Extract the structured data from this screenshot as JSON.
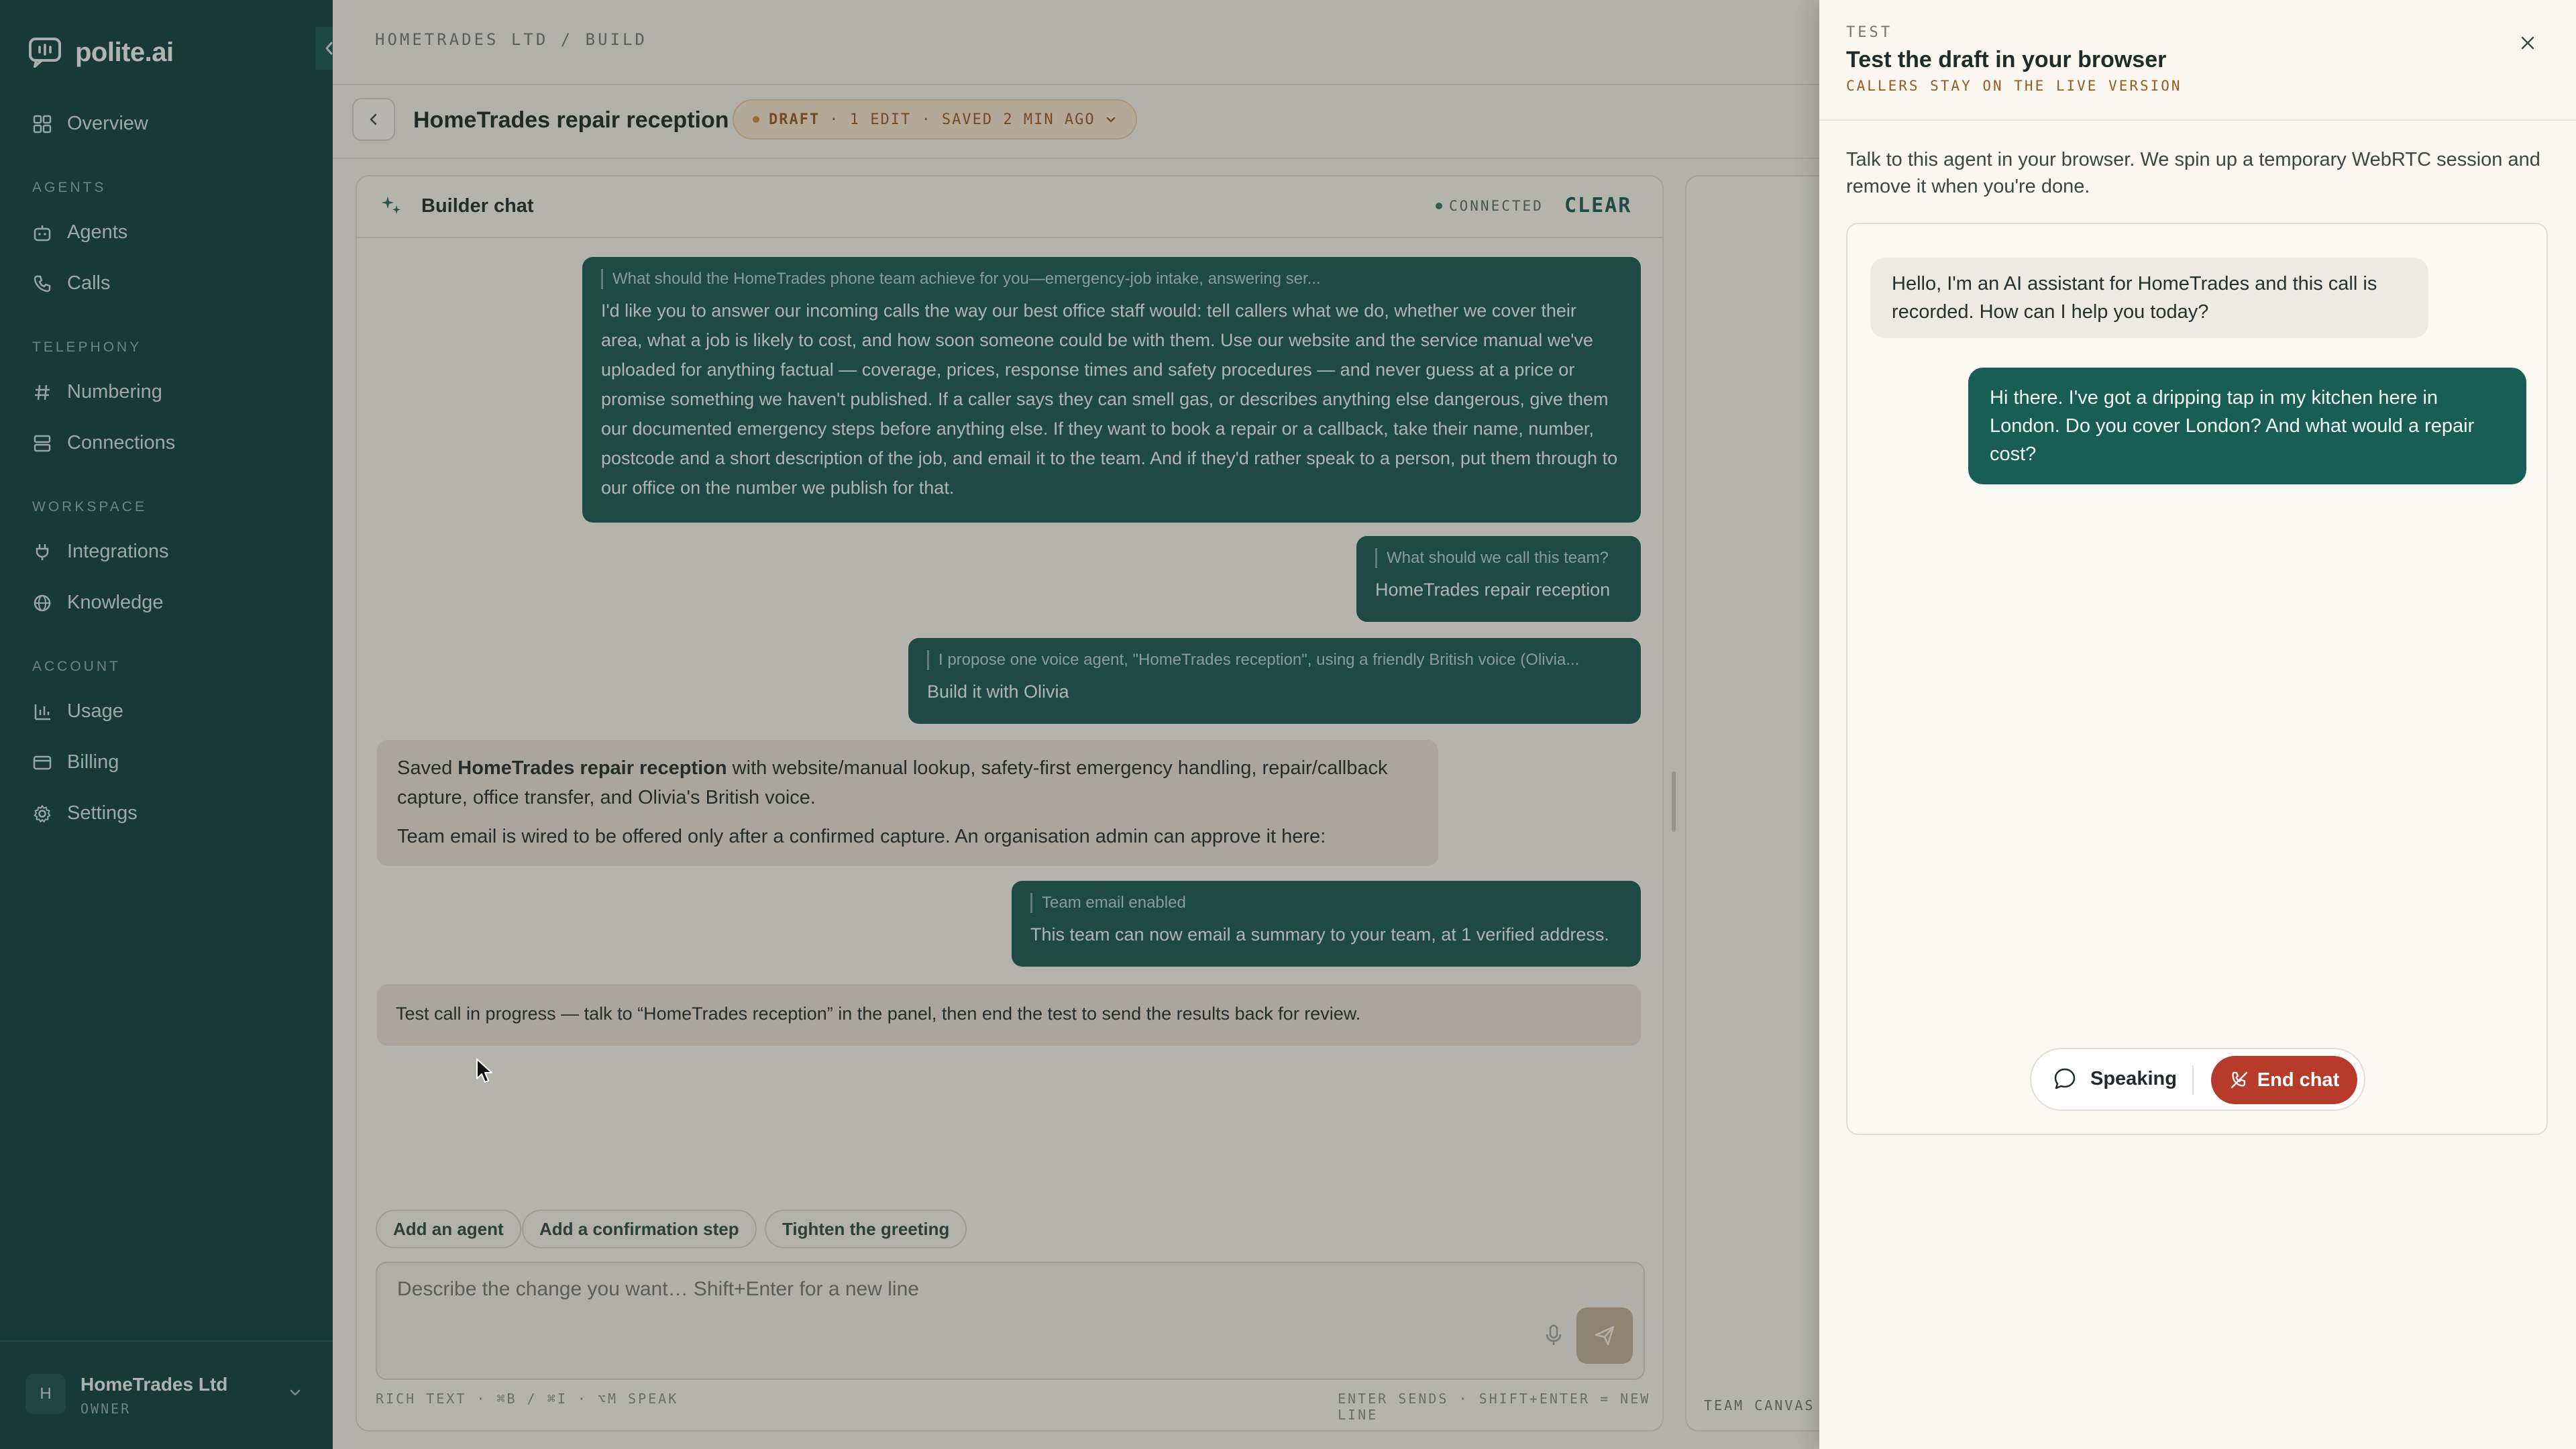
{
  "app": {
    "logo_text": "polite.ai",
    "brand_color": "#0f4340",
    "accent_color": "#1b5a52",
    "danger_color": "#b83a2b"
  },
  "sidebar": {
    "overview": "Overview",
    "sections": {
      "agents": "AGENTS",
      "telephony": "TELEPHONY",
      "workspace": "WORKSPACE",
      "account": "ACCOUNT"
    },
    "items": {
      "agents": "Agents",
      "calls": "Calls",
      "numbering": "Numbering",
      "connections": "Connections",
      "integrations": "Integrations",
      "knowledge": "Knowledge",
      "usage": "Usage",
      "billing": "Billing",
      "settings": "Settings"
    },
    "org": {
      "initial": "H",
      "name": "HomeTrades Ltd",
      "role": "OWNER"
    }
  },
  "header": {
    "breadcrumb": "HOMETRADES LTD / BUILD",
    "title": "HomeTrades repair reception",
    "draft_badge": {
      "status": "DRAFT",
      "detail": "· 1 EDIT · SAVED 2 MIN AGO"
    }
  },
  "builder_chat": {
    "title": "Builder chat",
    "connection": "CONNECTED",
    "clear_label": "CLEAR",
    "messages": [
      {
        "quote": "What should the HomeTrades phone team achieve for you—emergency-job intake, answering ser...",
        "text": "I'd like you to answer our incoming calls the way our best office staff would: tell callers what we do, whether we cover their area, what a job is likely to cost, and how soon someone could be with them. Use our website and the service manual we've uploaded for anything factual — coverage, prices, response times and safety procedures — and never guess at a price or promise something we haven't published. If a caller says they can smell gas, or describes anything else dangerous, give them our documented emergency steps before anything else. If they want to book a repair or a callback, take their name, number, postcode and a short description of the job, and email it to the team. And if they'd rather speak to a person, put them through to our office on the number we publish for that."
      },
      {
        "quote": "What should we call this team?",
        "text": "HomeTrades repair reception"
      },
      {
        "quote": "I propose one voice agent, \"HomeTrades reception\", using a friendly British voice (Olivia...",
        "text": "Build it with Olivia"
      },
      {
        "saved_prefix": "Saved ",
        "saved_name": "HomeTrades repair reception",
        "saved_suffix": " with website/manual lookup, safety-first emergency handling, repair/callback capture, office transfer, and Olivia's British voice.",
        "line2": "Team email is wired to be offered only after a confirmed capture. An organisation admin can approve it here:"
      },
      {
        "quote": "Team email enabled",
        "text": "This team can now email a summary to your team, at 1 verified address."
      },
      {
        "text": "Test call in progress — talk to “HomeTrades reception” in the panel, then end the test to send the results back for review."
      }
    ],
    "suggestions": [
      "Add an agent",
      "Add a confirmation step",
      "Tighten the greeting"
    ],
    "composer": {
      "placeholder": "Describe the change you want… Shift+Enter for a new line",
      "hint_left": "RICH TEXT · ⌘B / ⌘I · ⌥M SPEAK",
      "hint_right": "ENTER SENDS · SHIFT+ENTER = NEW LINE"
    }
  },
  "canvas": {
    "label": "TEAM CANVAS ·"
  },
  "test_panel": {
    "eyebrow": "TEST",
    "title": "Test the draft in your browser",
    "subtitle": "CALLERS STAY ON THE LIVE VERSION",
    "description": "Talk to this agent in your browser. We spin up a temporary WebRTC session and remove it when you're done.",
    "conversation": {
      "agent": "Hello, I'm an AI assistant for HomeTrades and this call is recorded. How can I help you today?",
      "user": "Hi there. I've got a dripping tap in my kitchen here in London. Do you cover London? And what would a repair cost?"
    },
    "controls": {
      "speaking": "Speaking",
      "end_chat": "End chat"
    }
  },
  "icons": [
    "logo-icon",
    "collapse-chevron-icon",
    "grid-icon",
    "bot-icon",
    "phone-icon",
    "hash-icon",
    "server-icon",
    "plug-icon",
    "globe-icon",
    "chart-icon",
    "card-icon",
    "gear-icon",
    "chevron-down-icon",
    "back-chevron-icon",
    "sparkle-icon",
    "mic-icon",
    "send-icon",
    "close-icon",
    "speech-bubble-icon",
    "phone-off-icon",
    "cursor-icon"
  ]
}
